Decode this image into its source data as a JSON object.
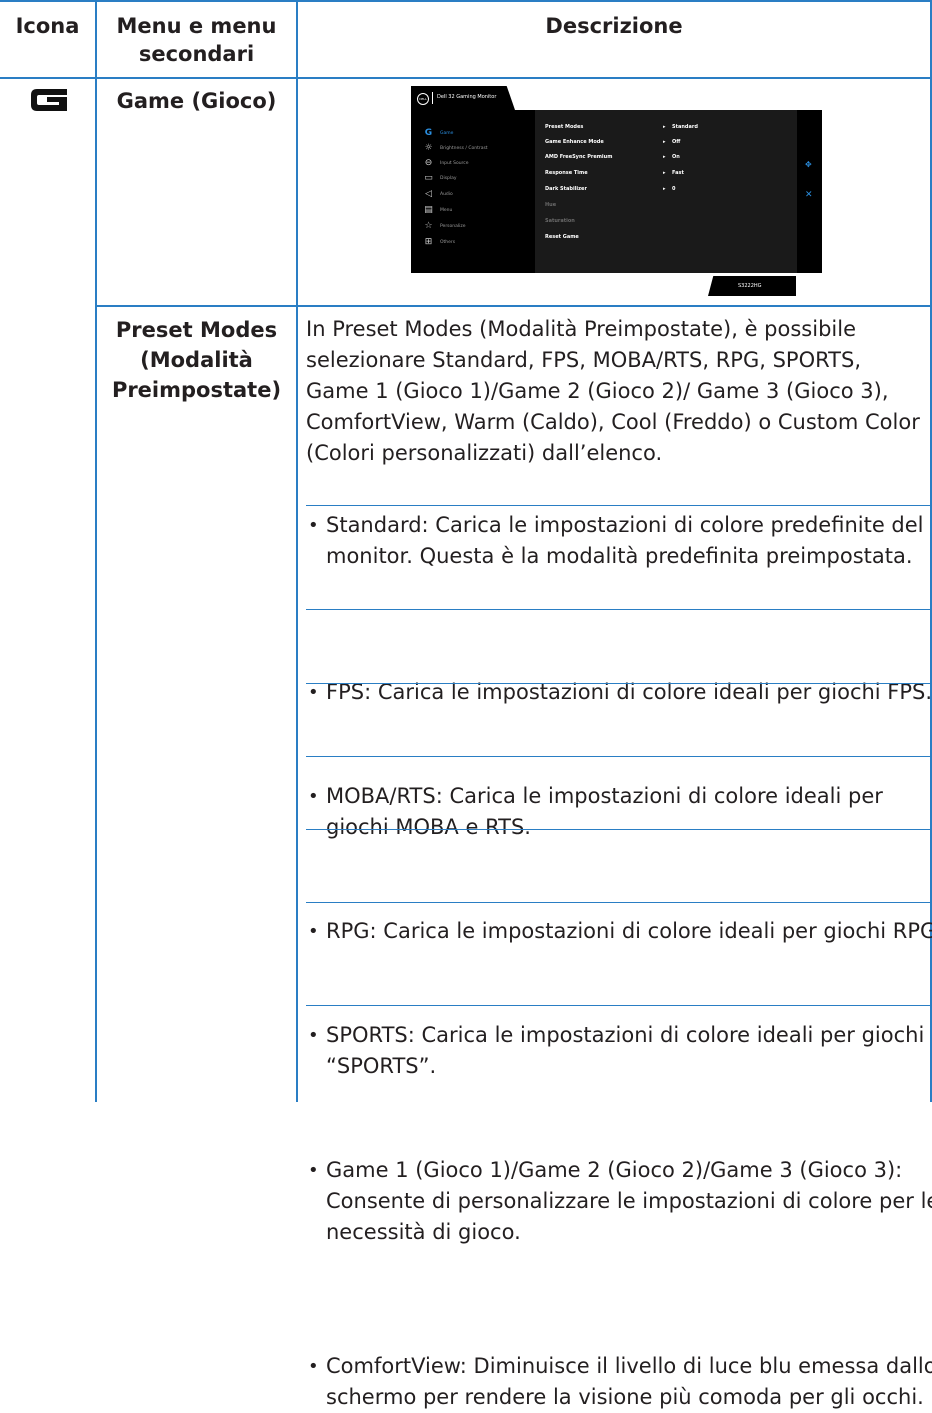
{
  "header": {
    "col1": "Icona",
    "col2_line1": "Menu e menu",
    "col2_line2": "secondari",
    "col3": "Descrizione"
  },
  "game_row": {
    "menu_label": "Game (Gioco)",
    "icon": "game-g-icon"
  },
  "osd": {
    "title": "Dell 32 Gaming Monitor",
    "model": "S3222HG",
    "menu_items": [
      {
        "label": "Game",
        "icon": "game-g-icon"
      },
      {
        "label": "Brightness / Contrast",
        "icon": "sun-icon"
      },
      {
        "label": "Input Source",
        "icon": "input-source-icon"
      },
      {
        "label": "Display",
        "icon": "display-icon"
      },
      {
        "label": "Audio",
        "icon": "speaker-icon"
      },
      {
        "label": "Menu",
        "icon": "menu-doc-icon"
      },
      {
        "label": "Personalize",
        "icon": "star-icon"
      },
      {
        "label": "Others",
        "icon": "others-icon"
      }
    ],
    "settings": [
      {
        "key": "Preset Modes",
        "value": "Standard"
      },
      {
        "key": "Game Enhance Mode",
        "value": "Off"
      },
      {
        "key": "AMD FreeSync Premium",
        "value": "On"
      },
      {
        "key": "Response Time",
        "value": "Fast"
      },
      {
        "key": "Dark Stabilizer",
        "value": "0"
      },
      {
        "key": "Hue",
        "value": ""
      },
      {
        "key": "Saturation",
        "value": ""
      },
      {
        "key": "Reset Game",
        "value": ""
      }
    ],
    "accent": "#2b8fe0"
  },
  "preset_row": {
    "menu_line1": "Preset Modes",
    "menu_line2": "(Modalità",
    "menu_line3": "Preimpostate)",
    "intro": {
      "p1": "In ",
      "t1": "Preset Modes (Modalità Preimpostate)",
      "p2": ", è possibile selezionare ",
      "t2": "Standard",
      "p3": ", ",
      "t3": "FPS",
      "p4": ", ",
      "t4": "MOBA/RTS",
      "p5": ", ",
      "t5": "RPG",
      "p6": ", ",
      "t6": "SPORTS",
      "p7": ", ",
      "t7": "Game 1 (Gioco 1)/Game 2 (Gioco 2)/ Game 3 (Gioco 3)",
      "p8": ", ",
      "t8": "ComfortView",
      "p9": ", ",
      "t9": "Warm (Caldo)",
      "p10": ", ",
      "t10": "Cool (Freddo)",
      "p11": " o ",
      "t11": "Custom Color (Colori personalizzati)",
      "p12": " dall’elenco."
    },
    "bullets": [
      {
        "term": "Standard:",
        "text": " Carica le impostazioni di colore predefinite del monitor. Questa è la modalità predefinita preimpostata."
      },
      {
        "term": "FPS:",
        "text": " Carica le impostazioni di colore ideali per giochi FPS."
      },
      {
        "term": "MOBA/RTS:",
        "text": " Carica le impostazioni di colore ideali per giochi MOBA e RTS."
      },
      {
        "term": "RPG:",
        "text": " Carica le impostazioni di colore ideali per giochi RPG."
      },
      {
        "term": "SPORTS:",
        "text": " Carica le impostazioni di colore ideali per giochi “SPORTS”."
      },
      {
        "term": "Game 1 (Gioco 1)/Game 2 (Gioco 2)/Game 3 (Gioco 3):",
        "text": " Consente di personalizzare le impostazioni di colore per le necessità di gioco."
      },
      {
        "term": "ComfortView:",
        "text": " Diminuisce il livello di luce blu emessa dallo schermo per rendere la visione più comoda per gli occhi."
      }
    ]
  }
}
